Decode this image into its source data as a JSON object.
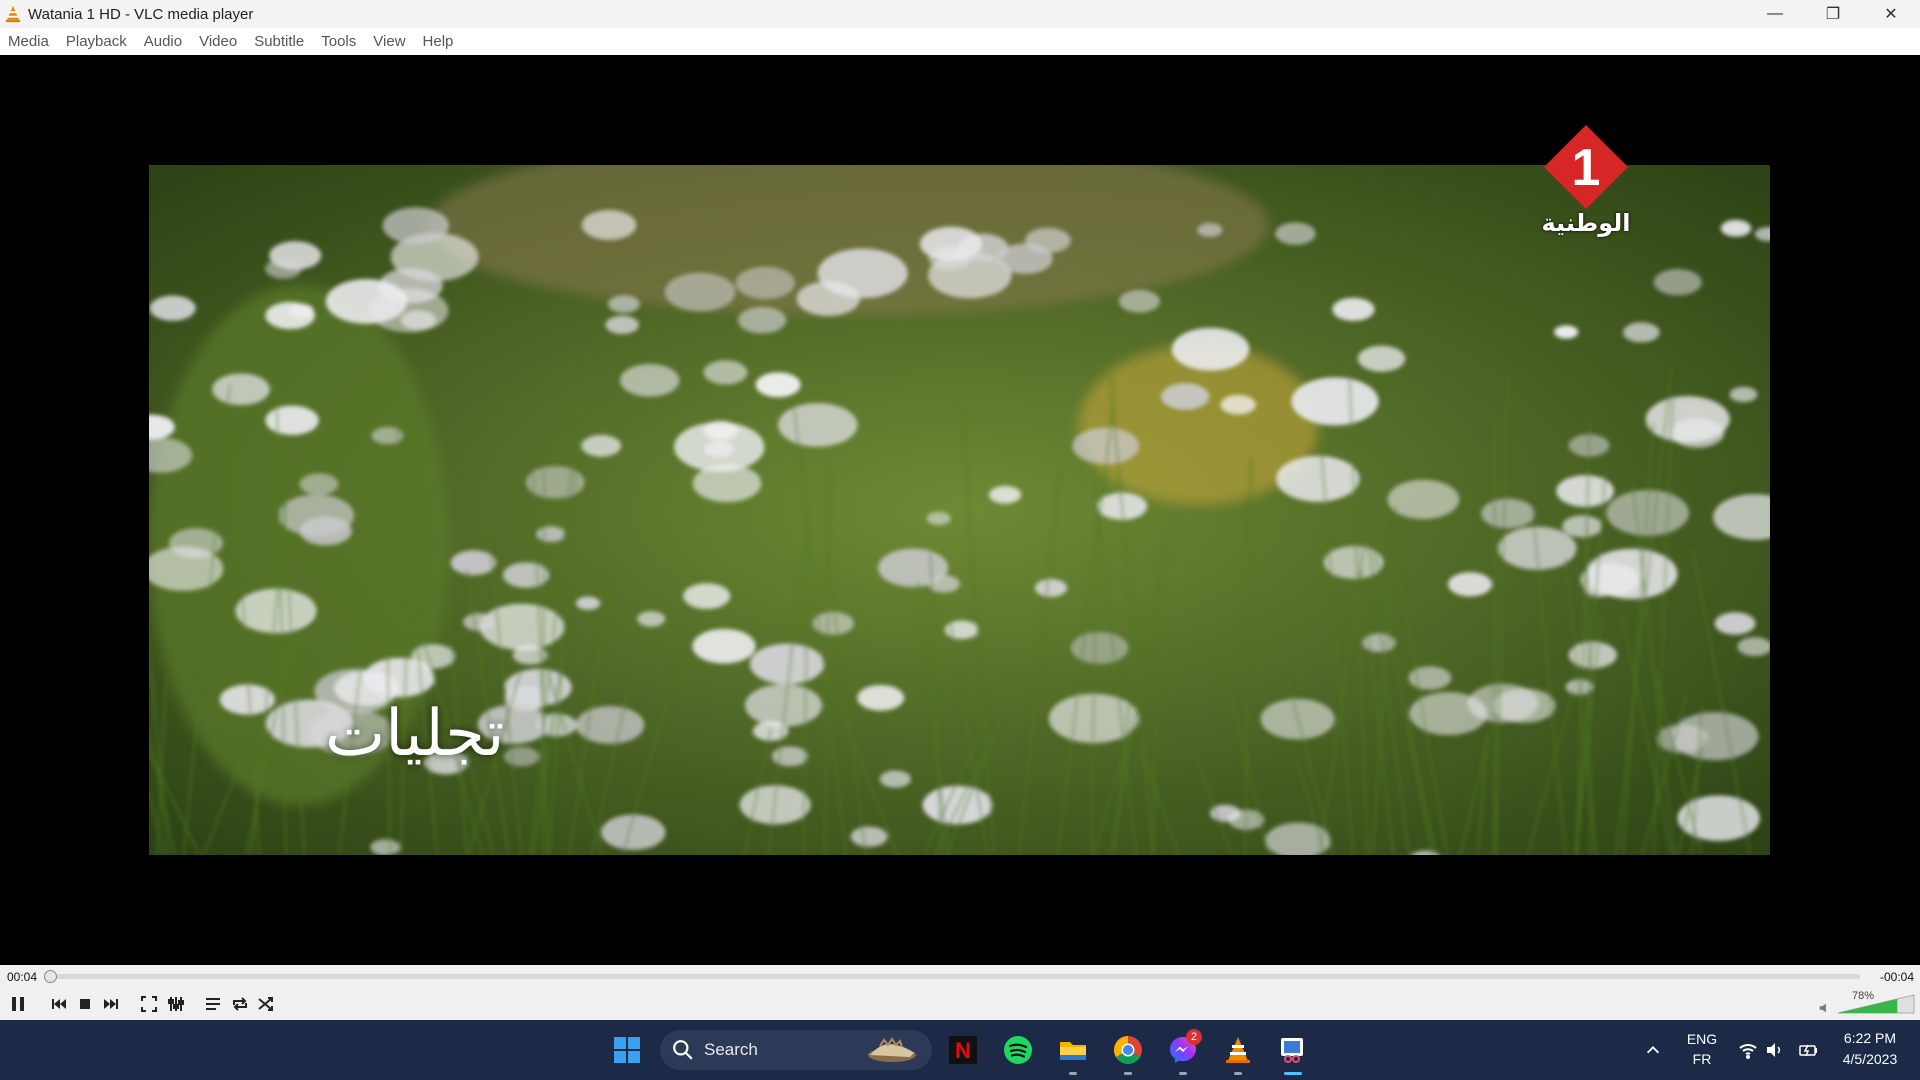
{
  "window": {
    "title": "Watania 1 HD - VLC media player",
    "minimize_icon": "minimize-icon",
    "restore_icon": "restore-icon",
    "close_icon": "close-icon"
  },
  "menu": {
    "items": [
      "Media",
      "Playback",
      "Audio",
      "Video",
      "Subtitle",
      "Tools",
      "View",
      "Help"
    ]
  },
  "video": {
    "channel_logo_number": "1",
    "channel_logo_text": "الوطنية",
    "program_title": "تجليات",
    "channel_color": "#d62626"
  },
  "player": {
    "time_elapsed": "00:04",
    "time_remaining": "-00:04",
    "progress_fraction": 0.0,
    "volume_label": "78%",
    "volume_fraction": 0.78,
    "buttons": [
      "pause-icon",
      "previous-icon",
      "stop-icon",
      "next-icon",
      "fullscreen-icon",
      "extended-settings-icon",
      "playlist-icon",
      "loop-icon",
      "shuffle-icon",
      "speaker-icon"
    ]
  },
  "taskbar": {
    "search_label": "Search",
    "apps": [
      "windows-start-icon",
      "search-icon",
      "netflix-icon",
      "spotify-icon",
      "file-explorer-icon",
      "chrome-icon",
      "messenger-icon",
      "vlc-icon",
      "snipping-tool-icon"
    ],
    "messenger_badge": "2",
    "language_top": "ENG",
    "language_bottom": "FR",
    "time": "6:22 PM",
    "date": "4/5/2023",
    "accent_color": "#1c2a48"
  }
}
